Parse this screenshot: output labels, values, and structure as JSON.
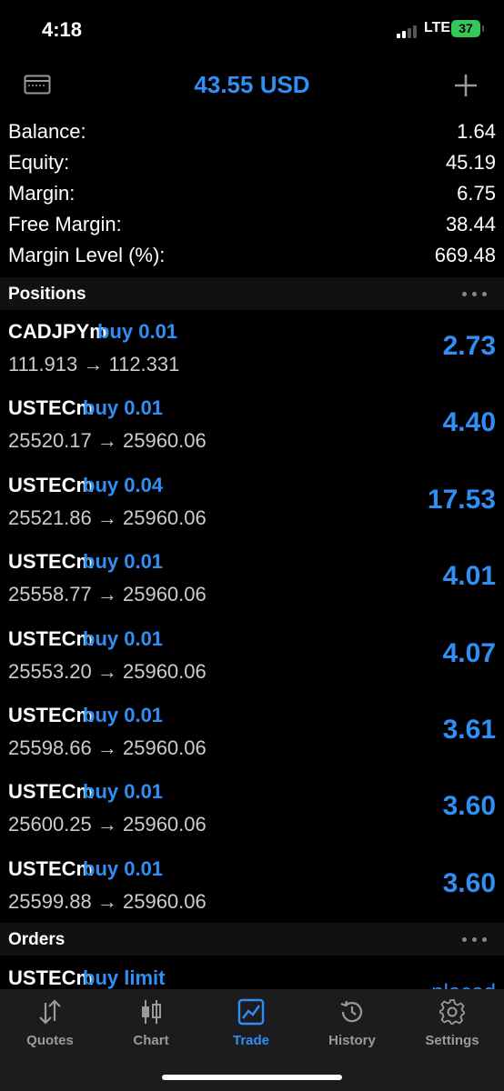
{
  "status_bar": {
    "time": "4:18",
    "network": "LTE",
    "battery": "37"
  },
  "header": {
    "title": "43.55 USD"
  },
  "summary": [
    {
      "label": "Balance:",
      "value": "1.64"
    },
    {
      "label": "Equity:",
      "value": "45.19"
    },
    {
      "label": "Margin:",
      "value": "6.75"
    },
    {
      "label": "Free Margin:",
      "value": "38.44"
    },
    {
      "label": "Margin Level (%):",
      "value": "669.48"
    }
  ],
  "positions": {
    "title": "Positions",
    "items": [
      {
        "symbol": "CADJPYm",
        "side": "buy 0.01",
        "prices": "111.913 → 112.331",
        "profit": "2.73"
      },
      {
        "symbol": "USTECm",
        "side": "buy 0.01",
        "prices": "25520.17 → 25960.06",
        "profit": "4.40"
      },
      {
        "symbol": "USTECm",
        "side": "buy 0.04",
        "prices": "25521.86 → 25960.06",
        "profit": "17.53"
      },
      {
        "symbol": "USTECm",
        "side": "buy 0.01",
        "prices": "25558.77 → 25960.06",
        "profit": "4.01"
      },
      {
        "symbol": "USTECm",
        "side": "buy 0.01",
        "prices": "25553.20 → 25960.06",
        "profit": "4.07"
      },
      {
        "symbol": "USTECm",
        "side": "buy 0.01",
        "prices": "25598.66 → 25960.06",
        "profit": "3.61"
      },
      {
        "symbol": "USTECm",
        "side": "buy 0.01",
        "prices": "25600.25 → 25960.06",
        "profit": "3.60"
      },
      {
        "symbol": "USTECm",
        "side": "buy 0.01",
        "prices": "25599.88 → 25960.06",
        "profit": "3.60"
      }
    ]
  },
  "orders": {
    "title": "Orders",
    "items": [
      {
        "symbol": "USTECm",
        "side": "buy limit",
        "status": "placed"
      }
    ]
  },
  "tabs": [
    {
      "label": "Quotes",
      "icon": "quotes-arrows-icon"
    },
    {
      "label": "Chart",
      "icon": "candlestick-icon"
    },
    {
      "label": "Trade",
      "icon": "trade-chart-icon",
      "active": true
    },
    {
      "label": "History",
      "icon": "history-clock-icon"
    },
    {
      "label": "Settings",
      "icon": "gear-icon"
    }
  ],
  "colors": {
    "accent": "#2f8ff5",
    "background": "#000000",
    "tab_bar": "#1c1c1e"
  }
}
